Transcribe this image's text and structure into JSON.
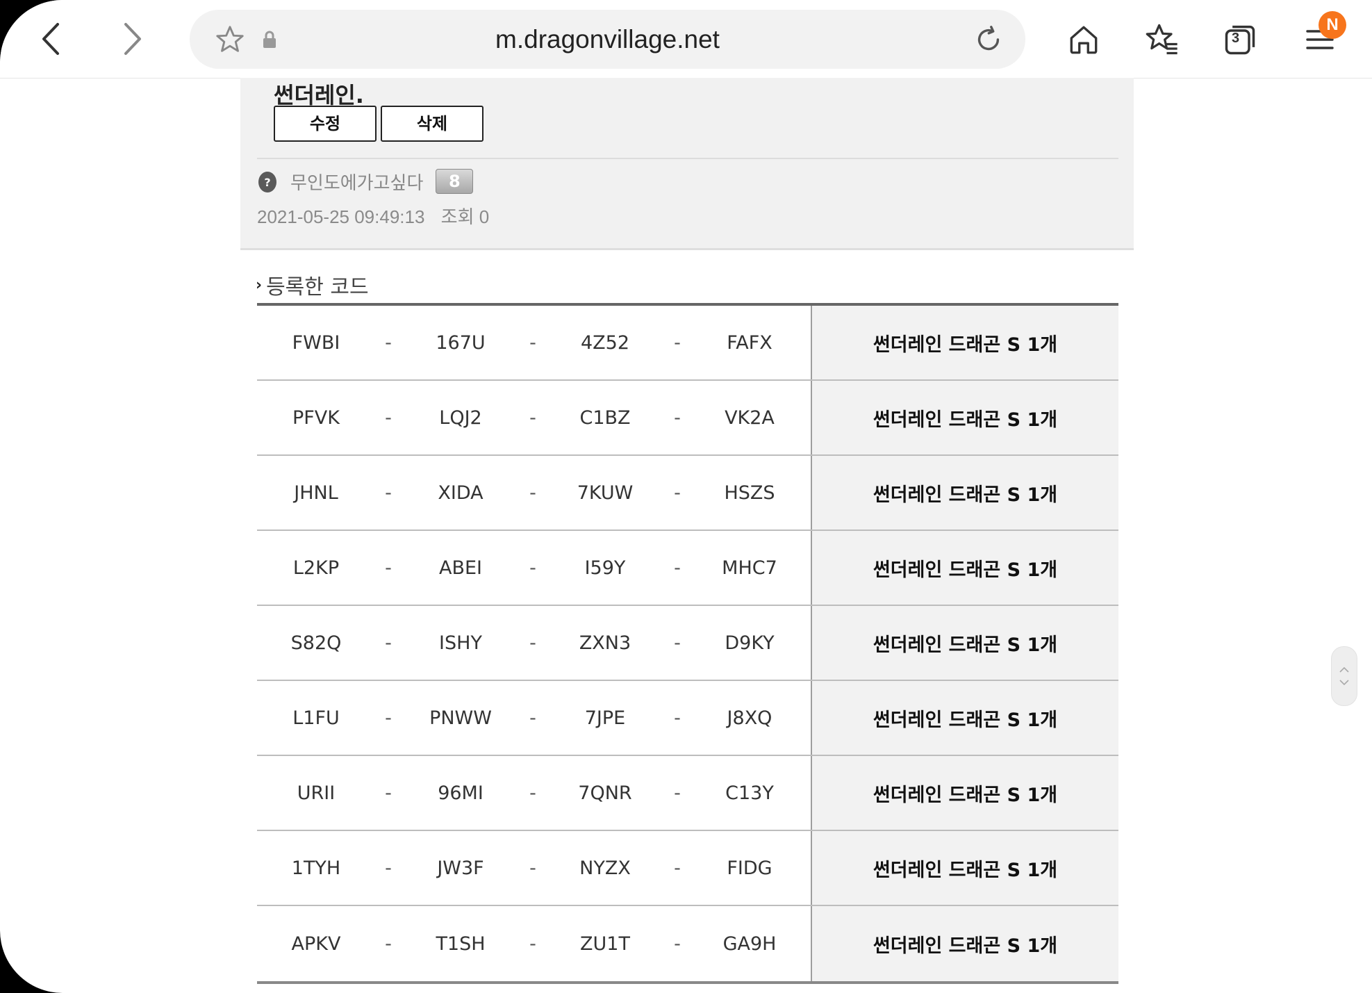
{
  "browser": {
    "url": "m.dragonvillage.net",
    "tabs_count": "3",
    "menu_badge": "N"
  },
  "post": {
    "body_tail": "썬더레인.",
    "edit_label": "수정",
    "delete_label": "삭제",
    "author": "무인도에가고싶다",
    "author_level": "8",
    "date": "2021-05-25 09:49:13",
    "views": "조회 0"
  },
  "section": {
    "title": "등록한 코드"
  },
  "codes": {
    "rows": [
      {
        "c1": "FWBI",
        "c2": "167U",
        "c3": "4Z52",
        "c4": "FAFX",
        "reward": "썬더레인 드래곤 S 1개"
      },
      {
        "c1": "PFVK",
        "c2": "LQJ2",
        "c3": "C1BZ",
        "c4": "VK2A",
        "reward": "썬더레인 드래곤 S 1개"
      },
      {
        "c1": "JHNL",
        "c2": "XIDA",
        "c3": "7KUW",
        "c4": "HSZS",
        "reward": "썬더레인 드래곤 S 1개"
      },
      {
        "c1": "L2KP",
        "c2": "ABEI",
        "c3": "I59Y",
        "c4": "MHC7",
        "reward": "썬더레인 드래곤 S 1개"
      },
      {
        "c1": "S82Q",
        "c2": "ISHY",
        "c3": "ZXN3",
        "c4": "D9KY",
        "reward": "썬더레인 드래곤 S 1개"
      },
      {
        "c1": "L1FU",
        "c2": "PNWW",
        "c3": "7JPE",
        "c4": "J8XQ",
        "reward": "썬더레인 드래곤 S 1개"
      },
      {
        "c1": "URII",
        "c2": "96MI",
        "c3": "7QNR",
        "c4": "C13Y",
        "reward": "썬더레인 드래곤 S 1개"
      },
      {
        "c1": "1TYH",
        "c2": "JW3F",
        "c3": "NYZX",
        "c4": "FIDG",
        "reward": "썬더레인 드래곤 S 1개"
      },
      {
        "c1": "APKV",
        "c2": "T1SH",
        "c3": "ZU1T",
        "c4": "GA9H",
        "reward": "썬더레인 드래곤 S 1개"
      }
    ],
    "separator": "-"
  },
  "colors": {
    "badge": "#f7751c",
    "post_bg": "#f1f1f1",
    "reward_bg": "#f2f2f2"
  },
  "icons": [
    "back-icon",
    "forward-icon",
    "star-icon",
    "lock-icon",
    "reload-icon",
    "home-icon",
    "bookmarks-icon",
    "tabs-icon",
    "menu-icon",
    "help-icon",
    "chevron-up-icon",
    "chevron-down-icon"
  ]
}
